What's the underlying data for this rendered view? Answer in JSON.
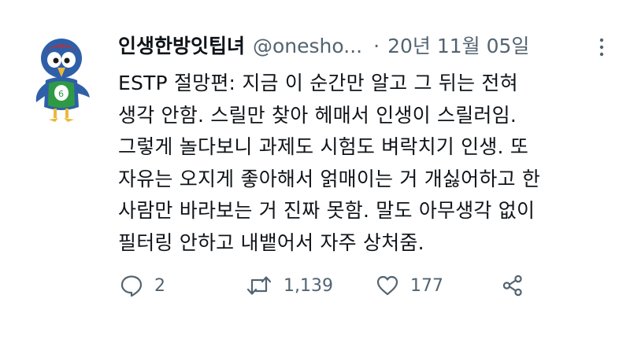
{
  "tweet": {
    "display_name": "인생한방잇팁녀",
    "handle": "@onesho...",
    "separator": "·",
    "date": "20년 11월 05일",
    "text": "ESTP 절망편: 지금 이 순간만 알고 그 뒤는 전혀\n생각 안함. 스릴만 찾아 헤매서 인생이 스릴러임.\n그렇게 놀다보니 과제도 시험도 벼락치기 인생. 또\n자유는 오지게 좋아해서 얽매이는 거 개싫어하고 한\n사람만 바라보는 거 진짜 못함. 말도 아무생각 없이\n필터링 안하고 내뱉어서 자주 상처줌.",
    "avatar_icon": "bird-mascot-icon",
    "more_icon": "more-dots-icon"
  },
  "actions": {
    "reply": {
      "icon": "reply-bubble-icon",
      "count": "2"
    },
    "retweet": {
      "icon": "retweet-icon",
      "count": "1,139"
    },
    "like": {
      "icon": "heart-icon",
      "count": "177"
    },
    "share": {
      "icon": "share-icon"
    }
  },
  "colors": {
    "text": "#0f1419",
    "secondary": "#536471",
    "background": "#ffffff"
  }
}
